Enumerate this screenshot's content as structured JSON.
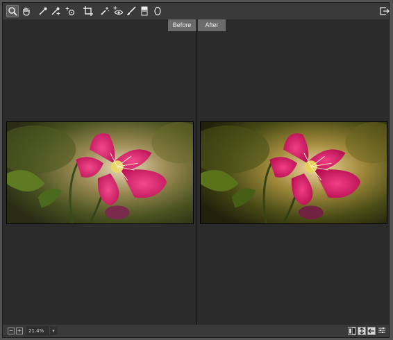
{
  "toolbar": {
    "tools": [
      "zoom-icon",
      "hand-icon",
      "eyedropper-icon",
      "color-sampler-icon",
      "target-adjust-icon",
      "crop-icon",
      "spot-removal-icon",
      "red-eye-icon",
      "brush-icon",
      "graduated-filter-icon",
      "radial-filter-icon"
    ],
    "right": "export-icon"
  },
  "compare": {
    "before_label": "Before",
    "after_label": "After"
  },
  "statusbar": {
    "zoom_out_glyph": "−",
    "zoom_in_glyph": "+",
    "zoom_level": "21.4%",
    "dropdown_glyph": "▾"
  },
  "colors": {
    "background": "#2b2b2b",
    "toolbar": "#3a3a3a",
    "tab": "#6b6b6b",
    "flower": "#d81e6a"
  }
}
